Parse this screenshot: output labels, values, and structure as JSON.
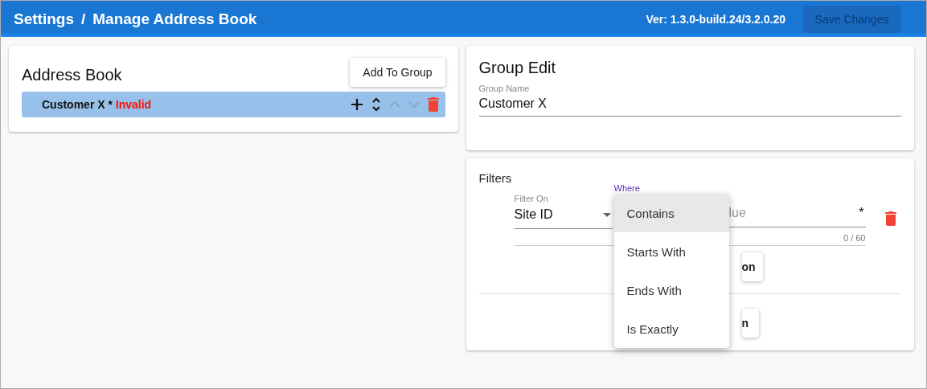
{
  "header": {
    "breadcrumb": [
      "Settings",
      "Manage Address Book"
    ],
    "separator": "/",
    "version": "Ver: 1.3.0-build.24/3.2.0.20",
    "save_button": {
      "label": "Save Changes",
      "disabled": true
    }
  },
  "address_book": {
    "title": "Address Book",
    "add_button": "Add To Group",
    "groups": [
      {
        "name": "Customer X *",
        "status": "Invalid",
        "selected": true
      }
    ]
  },
  "group_edit": {
    "title": "Group Edit",
    "field": {
      "label": "Group Name",
      "value": "Customer X"
    }
  },
  "filters": {
    "title": "Filters",
    "rows": [
      {
        "filter_on": {
          "label": "Filter On",
          "value": "Site ID"
        },
        "where": {
          "label": "Where"
        },
        "value": {
          "placeholder": "lue",
          "required": "*",
          "counter": "0 / 60"
        }
      }
    ],
    "buttons": [
      "on",
      "n"
    ]
  },
  "dropdown_menu": {
    "items": [
      {
        "label": "Contains",
        "selected": true
      },
      {
        "label": "Starts With",
        "selected": false
      },
      {
        "label": "Ends With",
        "selected": false
      },
      {
        "label": "Is Exactly",
        "selected": false
      }
    ]
  }
}
